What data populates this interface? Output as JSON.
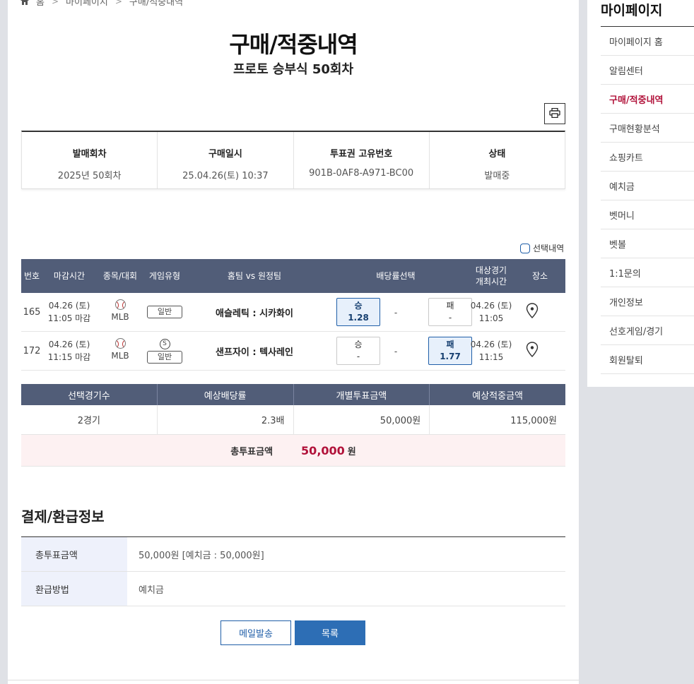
{
  "breadcrumb": {
    "home": "홈",
    "level1": "마이페이지",
    "level2": "구매/적중내역"
  },
  "page": {
    "title": "구매/적중내역",
    "subtitle": "프로토 승부식 50회차"
  },
  "info": {
    "cells": [
      {
        "label": "발매회차",
        "value": "2025년 50회차"
      },
      {
        "label": "구매일시",
        "value": "25.04.26(토) 10:37"
      },
      {
        "label": "투표권 고유번호",
        "value": "901B-0AF8-A971-BC00"
      },
      {
        "label": "상태",
        "value": "발매중"
      }
    ]
  },
  "select_check_label": "선택내역",
  "game_table": {
    "headers": {
      "no": "번호",
      "deadline": "마감시간",
      "sport": "종목/대회",
      "type": "게임유형",
      "teams": "홈팀 vs 원정팀",
      "odds": "배당률선택",
      "venue_time_1": "대상경기",
      "venue_time_2": "개최시간",
      "place": "장소"
    },
    "rows": [
      {
        "no": "165",
        "date": "04.26 (토)",
        "close": "11:05 마감",
        "league": "MLB",
        "type_badge": "",
        "type": "일반",
        "teams": "애슬레틱 : 시카화이",
        "win_label": "승",
        "win_odd": "1.28",
        "draw": "-",
        "lose_label": "패",
        "lose_odd": "-",
        "game_date": "04.26 (토)",
        "game_time": "11:05",
        "selected": "win"
      },
      {
        "no": "172",
        "date": "04.26 (토)",
        "close": "11:15 마감",
        "league": "MLB",
        "type_badge": "S",
        "type": "일반",
        "teams": "샌프자이 : 텍사레인",
        "win_label": "승",
        "win_odd": "-",
        "draw": "-",
        "lose_label": "패",
        "lose_odd": "1.77",
        "game_date": "04.26 (토)",
        "game_time": "11:15",
        "selected": "lose"
      }
    ]
  },
  "summary": {
    "headers": [
      "선택경기수",
      "예상배당률",
      "개별투표금액",
      "예상적중금액"
    ],
    "values": [
      "2경기",
      "2.3배",
      "50,000원",
      "115,000원"
    ],
    "total_label": "총투표금액",
    "total_amount": "50,000",
    "total_unit": "원"
  },
  "payment": {
    "title": "결제/환급정보",
    "rows": [
      {
        "key": "총투표금액",
        "value": "50,000원 [예치금 : 50,000원]"
      },
      {
        "key": "환급방법",
        "value": "예치금"
      }
    ]
  },
  "buttons": {
    "mail": "메일발송",
    "list": "목록"
  },
  "sidebar": {
    "title": "마이페이지",
    "items": [
      "마이페이지 홈",
      "알림센터",
      "구매/적중내역",
      "구매현황분석",
      "쇼핑카트",
      "예치금",
      "벳머니",
      "벳볼",
      "1:1문의",
      "개인정보",
      "선호게임/경기",
      "회원탈퇴"
    ],
    "active_index": 2
  },
  "colors": {
    "accent": "#b1123a",
    "header_bg": "#515d78",
    "primary_button": "#2d6eb5"
  }
}
